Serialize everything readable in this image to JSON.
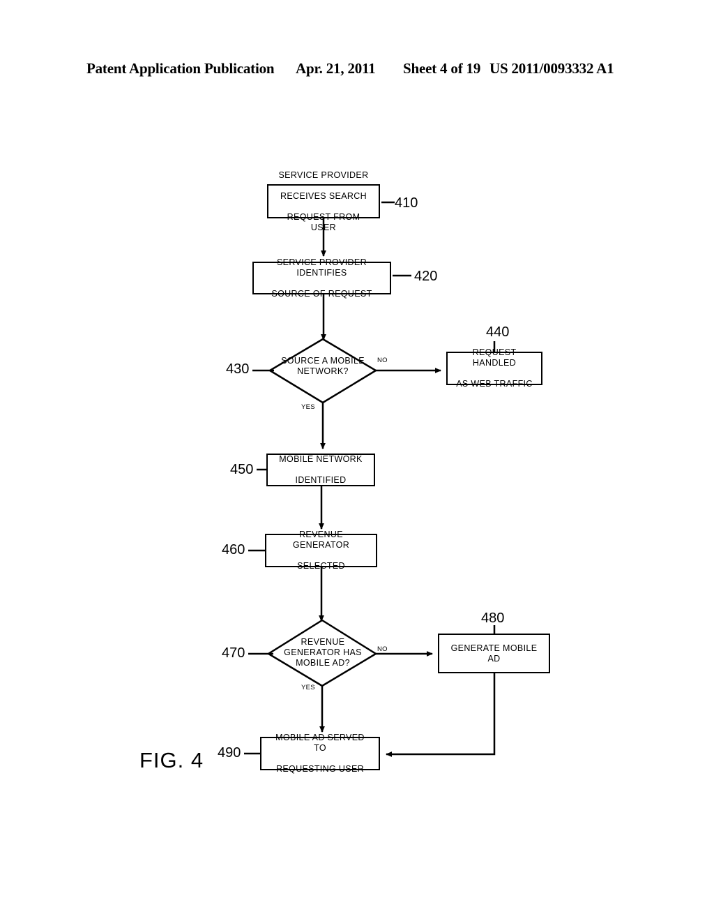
{
  "header": {
    "publication": "Patent Application Publication",
    "date": "Apr. 21, 2011",
    "sheet": "Sheet 4 of 19",
    "doc_number": "US 2011/0093332 A1"
  },
  "figure": {
    "caption": "FIG. 4",
    "nodes": {
      "n410": {
        "ref": "410",
        "line1": "SERVICE PROVIDER",
        "line2": "RECEIVES SEARCH",
        "line3": "REQUEST FROM USER"
      },
      "n420": {
        "ref": "420",
        "line1": "SERVICE PROVIDER IDENTIFIES",
        "line2": "SOURCE OF REQUEST"
      },
      "n430": {
        "ref": "430",
        "line1": "SOURCE A MOBILE",
        "line2": "NETWORK?"
      },
      "n440": {
        "ref": "440",
        "line1": "REQUEST HANDLED",
        "line2": "AS WEB TRAFFIC"
      },
      "n450": {
        "ref": "450",
        "line1": "MOBILE NETWORK",
        "line2": "IDENTIFIED"
      },
      "n460": {
        "ref": "460",
        "line1": "REVENUE GENERATOR",
        "line2": "SELECTED"
      },
      "n470": {
        "ref": "470",
        "line1": "REVENUE",
        "line2": "GENERATOR HAS",
        "line3": "MOBILE AD?"
      },
      "n480": {
        "ref": "480",
        "line1": "GENERATE MOBILE AD"
      },
      "n490": {
        "ref": "490",
        "line1": "MOBILE AD SERVED TO",
        "line2": "REQUESTING USER"
      }
    },
    "branches": {
      "yes_430": "YES",
      "no_430": "NO",
      "yes_470": "YES",
      "no_470": "NO"
    },
    "colors": {
      "stroke": "#000000",
      "fill": "#ffffff",
      "text": "#000000"
    }
  }
}
